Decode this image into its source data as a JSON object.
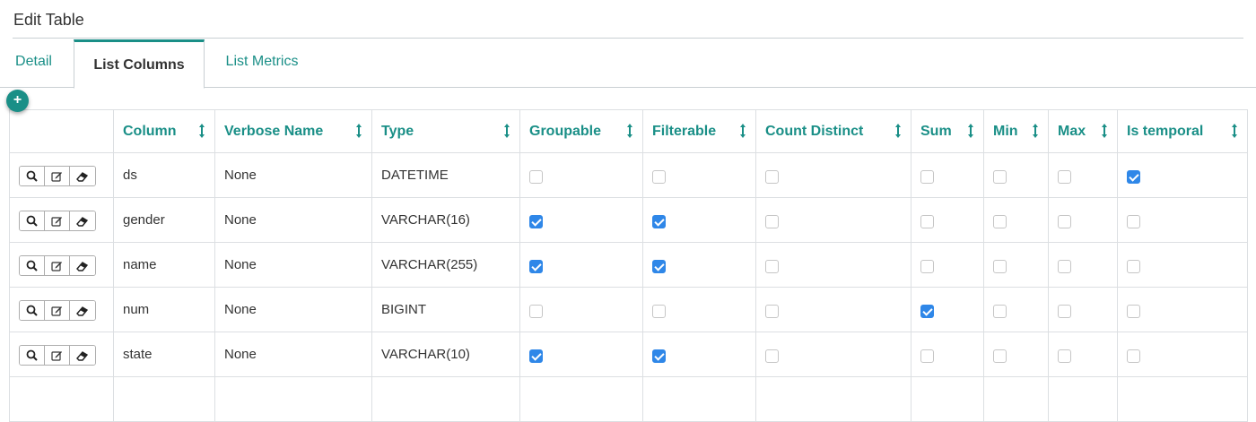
{
  "page": {
    "title": "Edit Table"
  },
  "tabs": [
    {
      "label": "Detail",
      "active": false
    },
    {
      "label": "List Columns",
      "active": true
    },
    {
      "label": "List Metrics",
      "active": false
    }
  ],
  "add_button": {
    "label": "+"
  },
  "table": {
    "headers": [
      "",
      "Column",
      "Verbose Name",
      "Type",
      "Groupable",
      "Filterable",
      "Count Distinct",
      "Sum",
      "Min",
      "Max",
      "Is temporal"
    ],
    "action_icons": [
      "search-icon",
      "edit-icon",
      "eraser-icon"
    ],
    "rows": [
      {
        "column": "ds",
        "verbose_name": "None",
        "type": "DATETIME",
        "groupable": false,
        "filterable": false,
        "count_distinct": false,
        "sum": false,
        "min": false,
        "max": false,
        "is_temporal": true
      },
      {
        "column": "gender",
        "verbose_name": "None",
        "type": "VARCHAR(16)",
        "groupable": true,
        "filterable": true,
        "count_distinct": false,
        "sum": false,
        "min": false,
        "max": false,
        "is_temporal": false
      },
      {
        "column": "name",
        "verbose_name": "None",
        "type": "VARCHAR(255)",
        "groupable": true,
        "filterable": true,
        "count_distinct": false,
        "sum": false,
        "min": false,
        "max": false,
        "is_temporal": false
      },
      {
        "column": "num",
        "verbose_name": "None",
        "type": "BIGINT",
        "groupable": false,
        "filterable": false,
        "count_distinct": false,
        "sum": true,
        "min": false,
        "max": false,
        "is_temporal": false
      },
      {
        "column": "state",
        "verbose_name": "None",
        "type": "VARCHAR(10)",
        "groupable": true,
        "filterable": true,
        "count_distinct": false,
        "sum": false,
        "min": false,
        "max": false,
        "is_temporal": false
      }
    ]
  },
  "colors": {
    "accent": "#1a8f87",
    "checkbox_checked": "#2f87e8",
    "border": "#dcdfe2"
  }
}
